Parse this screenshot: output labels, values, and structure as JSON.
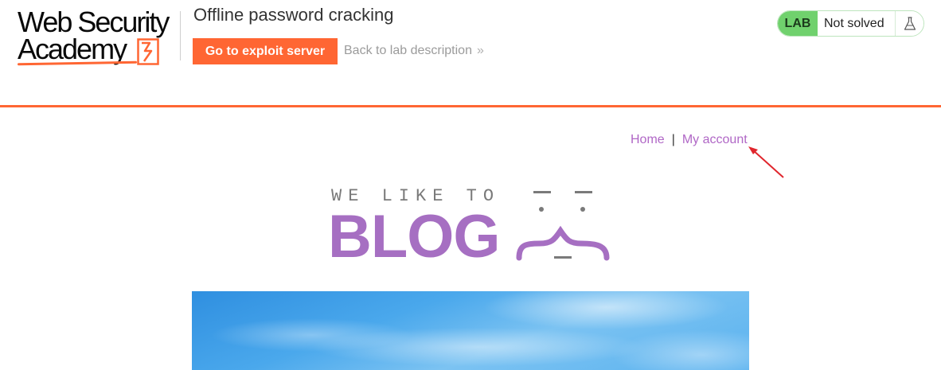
{
  "header": {
    "logo": {
      "line1": "Web Security",
      "line2": "Academy"
    },
    "lab_title": "Offline password cracking",
    "exploit_button": "Go to exploit server",
    "back_link": "Back to lab description",
    "back_chevron": "»",
    "lab_status": {
      "badge": "LAB",
      "state": "Not solved",
      "icon": "flask-icon"
    }
  },
  "nav": {
    "home": "Home",
    "separator": "|",
    "my_account": "My account"
  },
  "blog_header": {
    "tagline": "WE LIKE TO",
    "word": "BLOG"
  },
  "colors": {
    "brand_orange": "#ff6633",
    "link_purple": "#b067c6",
    "blog_purple": "#a66fc2",
    "lab_green": "#70d16d",
    "annotation_red": "#e0262d"
  }
}
